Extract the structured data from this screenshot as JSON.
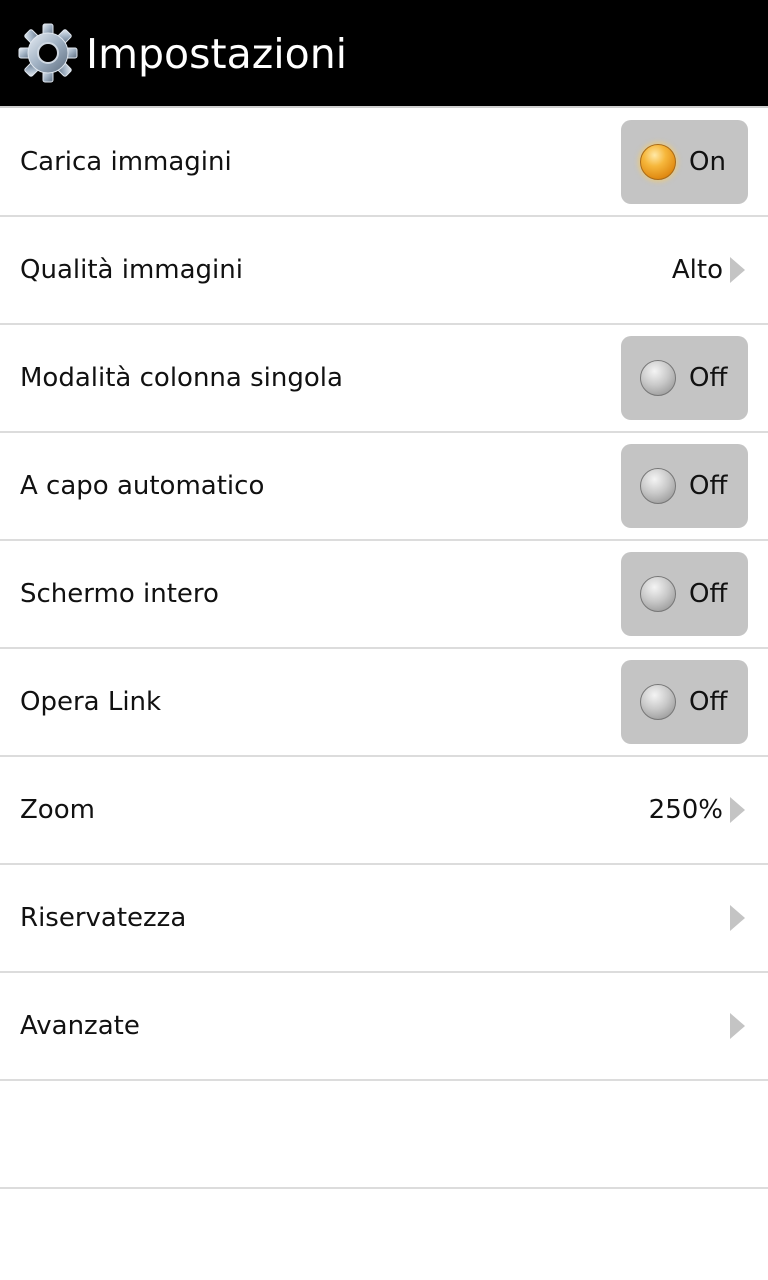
{
  "header": {
    "title": "Impostazioni",
    "icon": "gear-icon"
  },
  "colors": {
    "header_bg": "#000000",
    "toggle_bg": "#c4c4c4",
    "led_on": "#f6b73c",
    "led_off": "#bfbfbf",
    "separator": "#dcdcdc"
  },
  "settings": [
    {
      "label": "Carica immagini",
      "state": "On"
    },
    {
      "label": "Qualità immagini",
      "value": "Alto"
    },
    {
      "label": "Modalità colonna singola",
      "state": "Off"
    },
    {
      "label": "A capo automatico",
      "state": "Off"
    },
    {
      "label": "Schermo intero",
      "state": "Off"
    },
    {
      "label": "Opera Link",
      "state": "Off"
    },
    {
      "label": "Zoom",
      "value": "250%"
    },
    {
      "label": "Riservatezza",
      "value": ""
    },
    {
      "label": "Avanzate",
      "value": ""
    }
  ]
}
